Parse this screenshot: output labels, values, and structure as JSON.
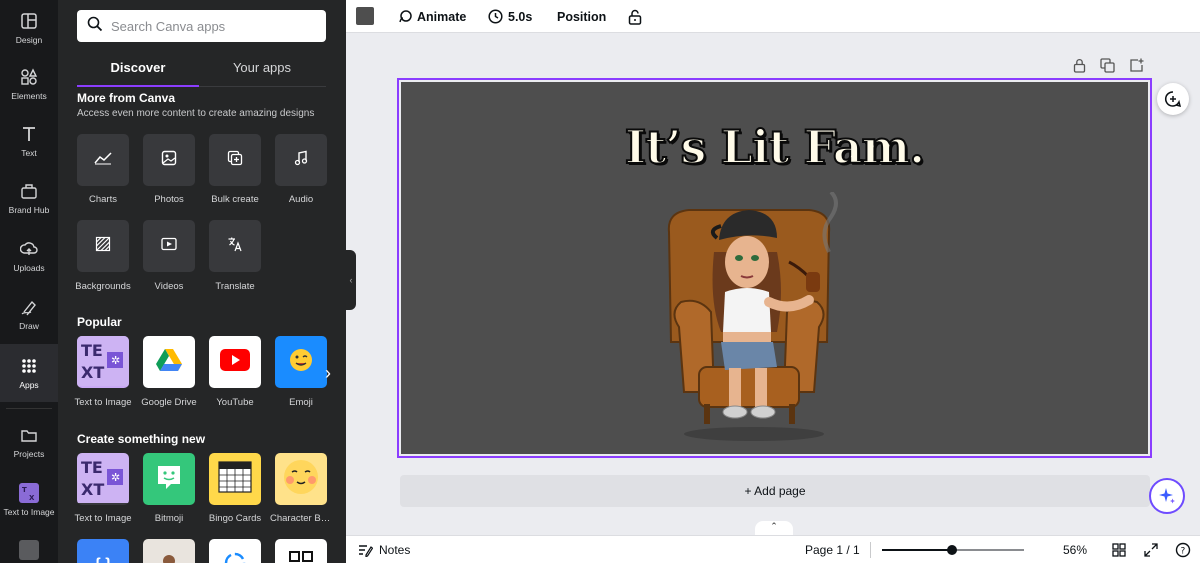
{
  "rail": {
    "items": [
      {
        "label": "Design",
        "icon": "design-icon"
      },
      {
        "label": "Elements",
        "icon": "elements-icon"
      },
      {
        "label": "Text",
        "icon": "text-icon"
      },
      {
        "label": "Brand Hub",
        "icon": "brand-hub-icon"
      },
      {
        "label": "Uploads",
        "icon": "uploads-icon"
      },
      {
        "label": "Draw",
        "icon": "draw-icon"
      },
      {
        "label": "Apps",
        "icon": "apps-icon",
        "active": true
      },
      {
        "label": "Projects",
        "icon": "projects-icon"
      },
      {
        "label": "Text to Image",
        "icon": "text-to-image-icon"
      }
    ]
  },
  "panel": {
    "search_placeholder": "Search Canva apps",
    "tabs": [
      {
        "label": "Discover",
        "active": true
      },
      {
        "label": "Your apps"
      }
    ],
    "more_from_canva": {
      "title": "More from Canva",
      "subtitle": "Access even more content to create amazing designs",
      "items": [
        {
          "label": "Charts",
          "icon": "chart-icon"
        },
        {
          "label": "Photos",
          "icon": "photo-icon"
        },
        {
          "label": "Bulk create",
          "icon": "bulk-create-icon"
        },
        {
          "label": "Audio",
          "icon": "music-note-icon"
        },
        {
          "label": "Backgrounds",
          "icon": "background-icon"
        },
        {
          "label": "Videos",
          "icon": "video-icon"
        },
        {
          "label": "Translate",
          "icon": "translate-icon"
        }
      ]
    },
    "popular": {
      "title": "Popular",
      "items": [
        {
          "label": "Text to Image",
          "icon": "text-to-image-app-icon"
        },
        {
          "label": "Google Drive",
          "icon": "google-drive-icon"
        },
        {
          "label": "YouTube",
          "icon": "youtube-icon"
        },
        {
          "label": "Emoji",
          "icon": "emoji-icon"
        }
      ]
    },
    "create_new": {
      "title": "Create something new",
      "items": [
        {
          "label": "Text to Image",
          "icon": "text-to-image-app-icon"
        },
        {
          "label": "Bitmoji",
          "icon": "bitmoji-icon"
        },
        {
          "label": "Bingo Cards",
          "icon": "bingo-card-icon"
        },
        {
          "label": "Character Builder",
          "icon": "character-builder-icon"
        }
      ]
    }
  },
  "topbar": {
    "color_swatch": "#4e4e4e",
    "animate": "Animate",
    "duration": "5.0s",
    "position": "Position"
  },
  "canvas": {
    "background": "#4e4e4e",
    "headline": "It’s Lit Fam.",
    "add_page": "+ Add page"
  },
  "bottombar": {
    "notes": "Notes",
    "page_indicator": "Page 1 / 1",
    "zoom_fraction": 0.49,
    "zoom_text": "56%"
  },
  "colors": {
    "accent": "#8b3dff",
    "rail_bg": "#18191b",
    "panel_bg": "#252627"
  }
}
